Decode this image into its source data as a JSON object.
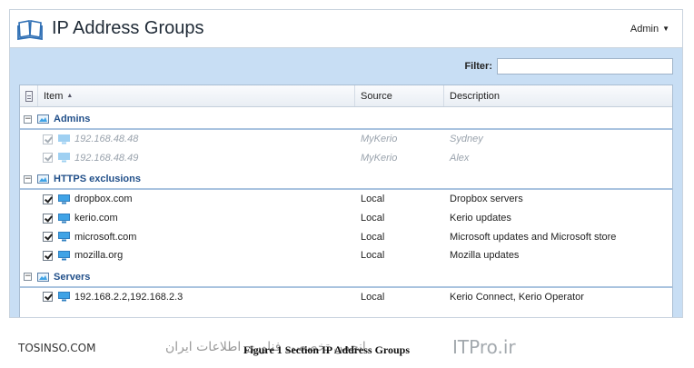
{
  "header": {
    "title": "IP Address Groups",
    "user_menu": "Admin"
  },
  "filter": {
    "label": "Filter:",
    "value": "",
    "placeholder": ""
  },
  "columns": {
    "item": "Item",
    "source": "Source",
    "description": "Description"
  },
  "groups": [
    {
      "name": "Admins",
      "rows": [
        {
          "item": "192.168.48.48",
          "source": "MyKerio",
          "description": "Sydney",
          "checked": true,
          "disabled": true
        },
        {
          "item": "192.168.48.49",
          "source": "MyKerio",
          "description": "Alex",
          "checked": true,
          "disabled": true
        }
      ]
    },
    {
      "name": "HTTPS exclusions",
      "rows": [
        {
          "item": "dropbox.com",
          "source": "Local",
          "description": "Dropbox servers",
          "checked": true,
          "disabled": false
        },
        {
          "item": "kerio.com",
          "source": "Local",
          "description": "Kerio updates",
          "checked": true,
          "disabled": false
        },
        {
          "item": "microsoft.com",
          "source": "Local",
          "description": "Microsoft updates and Microsoft store",
          "checked": true,
          "disabled": false
        },
        {
          "item": "mozilla.org",
          "source": "Local",
          "description": "Mozilla updates",
          "checked": true,
          "disabled": false
        }
      ]
    },
    {
      "name": "Servers",
      "rows": [
        {
          "item": "192.168.2.2,192.168.2.3",
          "source": "Local",
          "description": "Kerio Connect, Kerio Operator",
          "checked": true,
          "disabled": false
        }
      ]
    }
  ],
  "footer": {
    "site": "TOSINSO.COM",
    "caption": "Figure 1    Section IP Address Groups",
    "watermark_persian": "انجمن تخصصی فناوری اطلاعات ایران",
    "watermark_site": "ITPro.ir"
  },
  "colors": {
    "panel_blue": "#c8def4",
    "group_text": "#22508a",
    "icon_blue": "#3fa3e6"
  }
}
